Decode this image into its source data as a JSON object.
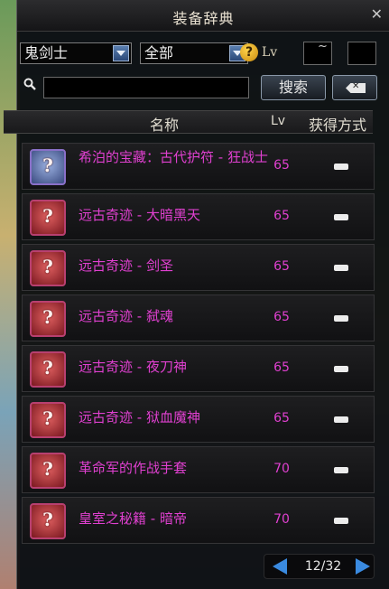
{
  "window": {
    "title": "装备辞典",
    "close_label": "✕"
  },
  "filters": {
    "class_value": "鬼剑士",
    "category_value": "全部",
    "lv_label": "Lv",
    "tilde": "~",
    "search_button": "搜索"
  },
  "table": {
    "headers": {
      "name": "名称",
      "lv": "Lv",
      "source": "获得方式"
    },
    "rows": [
      {
        "name": "希泊的宝藏：古代护符 - 狂战士",
        "lv": "65",
        "icon": "blue-card-icon"
      },
      {
        "name": "远古奇迹 - 大暗黑天",
        "lv": "65",
        "icon": "red-card-icon"
      },
      {
        "name": "远古奇迹 - 剑圣",
        "lv": "65",
        "icon": "red-card-icon"
      },
      {
        "name": "远古奇迹 - 弑魂",
        "lv": "65",
        "icon": "red-card-icon"
      },
      {
        "name": "远古奇迹 - 夜刀神",
        "lv": "65",
        "icon": "red-card-icon"
      },
      {
        "name": "远古奇迹 - 狱血魔神",
        "lv": "65",
        "icon": "red-card-icon"
      },
      {
        "name": "革命军的作战手套",
        "lv": "70",
        "icon": "red-card-icon"
      },
      {
        "name": "皇室之秘籍 - 暗帝",
        "lv": "70",
        "icon": "red-card-icon"
      }
    ]
  },
  "pager": {
    "text": "12/32"
  },
  "colors": {
    "item_name": "#e040d0",
    "accent_blue": "#3a8ae0"
  }
}
